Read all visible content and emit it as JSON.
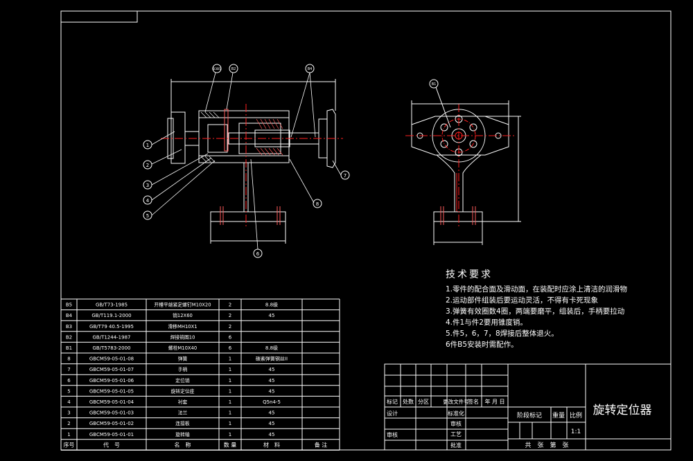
{
  "tech_req": {
    "title": "技术要求",
    "lines": [
      "1.零件的配合面及滑动面，在装配时应涂上清洁的润滑物",
      "2.运动部件组装后要运动灵活，不得有卡死现象",
      "3.弹簧有效圈数4圈，两端要磨平，组装后，手柄要拉动",
      "4.件1与件2要用锥度销。",
      "5.件5，6，7，8焊接后整体退火。",
      "6件B5安装时需配作。"
    ]
  },
  "balloons": {
    "main": [
      "1",
      "2",
      "3",
      "4",
      "5",
      "6",
      "7",
      "8"
    ],
    "top_left": "B3B5",
    "top_mid": "B2",
    "top_right": "B4",
    "side": "B1"
  },
  "parts_list": {
    "headers": [
      "序号",
      "代　号",
      "名　称",
      "数 量",
      "材　料",
      "备 注"
    ],
    "rows": [
      [
        "B5",
        "GB/T73-1985",
        "开槽平端紧定螺钉M10X20",
        "2",
        "8.8级",
        ""
      ],
      [
        "B4",
        "GB/T119.1-2000",
        "销12X60",
        "2",
        "45",
        ""
      ],
      [
        "B3",
        "GB/T79 40.5-1995",
        "滑移MH10X1",
        "2",
        "",
        ""
      ],
      [
        "B2",
        "GB/T1244-1987",
        "焊接销图10",
        "6",
        "",
        ""
      ],
      [
        "B1",
        "GB/T5783-2000",
        "螺栓M10X40",
        "6",
        "8.8级",
        ""
      ],
      [
        "8",
        "GBCM59-05-01-08",
        "弹簧",
        "1",
        "碳素弹簧钢丝II",
        ""
      ],
      [
        "7",
        "GBCM59-05-01-07",
        "手柄",
        "1",
        "45",
        ""
      ],
      [
        "6",
        "GBCM59-05-01-06",
        "定位销",
        "1",
        "45",
        ""
      ],
      [
        "5",
        "GBCM59-05-01-05",
        "旋转定位座",
        "1",
        "45",
        ""
      ],
      [
        "4",
        "GBCM59-05-01-04",
        "衬套",
        "1",
        "Q5n4-5",
        ""
      ],
      [
        "3",
        "GBCM59-05-01-03",
        "法兰",
        "1",
        "45",
        ""
      ],
      [
        "2",
        "GBCM59-05-01-02",
        "连接板",
        "1",
        "45",
        ""
      ],
      [
        "1",
        "GBCM59-05-01-01",
        "旋转轴",
        "1",
        "45",
        ""
      ]
    ]
  },
  "title_block": {
    "drawing_title": "旋转定位器",
    "rev_headers": [
      "标记",
      "处数",
      "分区",
      "更改文件号",
      "签名",
      "年 月 日"
    ],
    "designer": "设计",
    "standardize": "标准化",
    "checker": "审核",
    "craft": "工艺",
    "approve": "批准",
    "gong_zhang": "共　张　第　张",
    "stage_marks": "阶段标记",
    "weight": "重量",
    "ratio_label": "比例",
    "ratio": "1:1",
    "review": "审核"
  },
  "colors": {
    "line": "#ffffff",
    "center": "#ff2020",
    "thread": "#ff5a5a",
    "highlight": "#ffff00",
    "bg": "#000000"
  }
}
